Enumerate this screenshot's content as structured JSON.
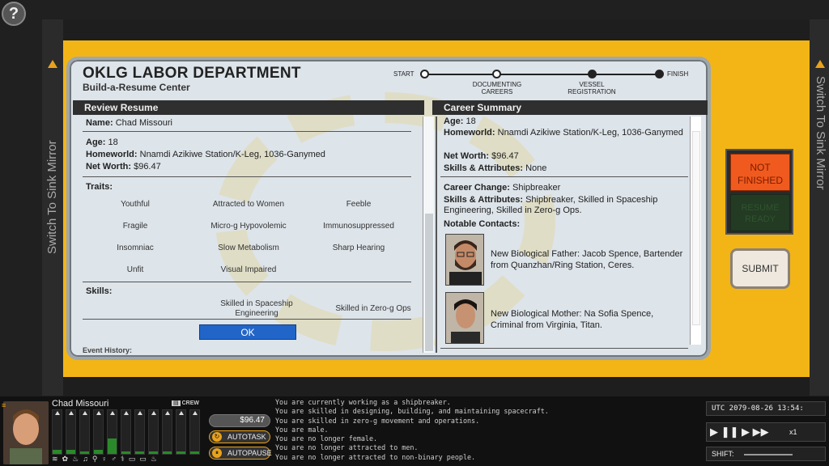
{
  "side": {
    "left_label": "Switch To Sink Mirror",
    "right_label": "Switch To Sink Mirror"
  },
  "header": {
    "title": "OKLG LABOR DEPARTMENT",
    "subtitle": "Build-a-Resume Center"
  },
  "progress": {
    "steps": [
      {
        "label": "START",
        "state": "done"
      },
      {
        "label": "DOCUMENTING CAREERS",
        "state": "current"
      },
      {
        "label": "VESSEL REGISTRATION",
        "state": "done"
      },
      {
        "label": "FINISH",
        "state": "done"
      }
    ]
  },
  "review": {
    "section_title": "Review Resume",
    "name_label": "Name:",
    "name": "Chad Missouri",
    "age_label": "Age:",
    "age": "18",
    "homeworld_label": "Homeworld:",
    "homeworld": "Nnamdi Azikiwe Station/K-Leg, 1036-Ganymed",
    "networth_label": "Net Worth:",
    "networth": "$96.47",
    "traits_label": "Traits:",
    "traits": [
      "Youthful",
      "Attracted to Women",
      "Feeble",
      "Fragile",
      "Micro-g Hypovolemic",
      "Immunosuppressed",
      "Insomniac",
      "Slow Metabolism",
      "Sharp Hearing",
      "Unfit",
      "Visual Impaired"
    ],
    "skills_label": "Skills:",
    "skills": [
      "Skilled in Spaceship Engineering",
      "Skilled in Zero-g Ops"
    ],
    "ok_label": "OK",
    "cut_label": "Event History:"
  },
  "career": {
    "section_title": "Career Summary",
    "age_label": "Age:",
    "age": "18",
    "homeworld_label": "Homeworld:",
    "homeworld": "Nnamdi Azikiwe Station/K-Leg, 1036-Ganymed",
    "networth_label": "Net Worth:",
    "networth": "$96.47",
    "skills_attr_label": "Skills & Attributes:",
    "skills_attr": "None",
    "change_label": "Career Change:",
    "change": "Shipbreaker",
    "skills_attr2_label": "Skills & Attributes:",
    "skills_attr2": "Shipbreaker, Skilled in Spaceship Engineering, Skilled in Zero-g Ops.",
    "contacts_label": "Notable Contacts:",
    "contacts": [
      {
        "text": "New Biological Father: Jacob Spence, Bartender from Quanzhan/Ring Station, Ceres."
      },
      {
        "text": "New Biological Mother: Na Sofia Spence, Criminal from Virginia, Titan."
      }
    ]
  },
  "status": {
    "not_finished": "NOT FINISHED",
    "resume_ready": "RESUME READY",
    "submit": "SUBMIT"
  },
  "hud": {
    "player_name": "Chad Missouri",
    "crew_label": "CREW",
    "money": "$96.47",
    "autotask": "AUTOTASK",
    "autopause": "AUTOPAUSE",
    "meter_levels": [
      0.1,
      0.1,
      0.05,
      0.1,
      0.35,
      0.05,
      0.05,
      0.05,
      0.05,
      0.05,
      0.05
    ],
    "log": [
      "You are currently working as a shipbreaker.",
      "You are skilled in designing, building, and maintaining spacecraft.",
      "You are skilled in zero-g movement and operations.",
      "You are male.",
      "You are no longer female.",
      "You are no longer attracted to men.",
      "You are no longer attracted to non-binary people."
    ],
    "datetime": "UTC 2079-08-26 13:54:",
    "speed": "x1",
    "shift_label": "SHIFT:"
  }
}
